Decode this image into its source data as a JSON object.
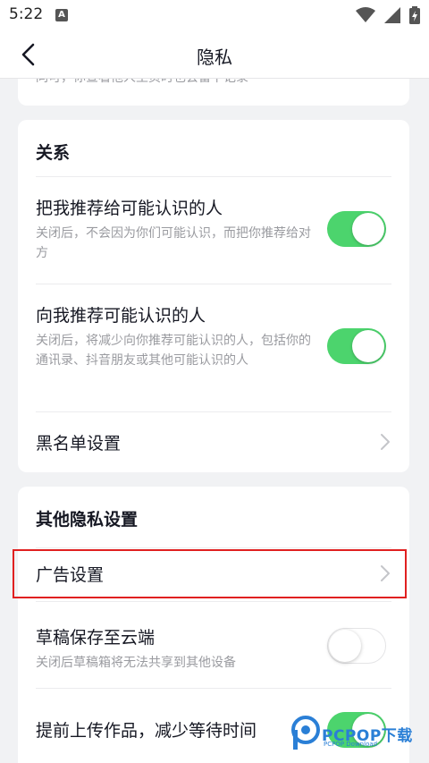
{
  "status_bar": {
    "time": "5:22",
    "notification_icon": "A",
    "icons": [
      "wifi-icon",
      "signal-icon",
      "battery-charging-icon"
    ]
  },
  "nav": {
    "title": "隐私",
    "back_icon": "chevron-left-icon"
  },
  "top_partial": {
    "text": "同可，你查看他人主页时也会留下记录"
  },
  "relations": {
    "title": "关系",
    "items": [
      {
        "label": "把我推荐给可能认识的人",
        "desc": "关闭后，不会因为你们可能认识，而把你推荐给对方",
        "toggle": "on"
      },
      {
        "label": "向我推荐可能认识的人",
        "desc": "关闭后，将减少向你推荐可能认识的人，包括你的通讯录、抖音朋友或其他可能认识的人",
        "toggle": "on"
      },
      {
        "label": "黑名单设置",
        "icon": "chevron-right-icon"
      }
    ]
  },
  "other": {
    "title": "其他隐私设置",
    "items": [
      {
        "label": "广告设置",
        "icon": "chevron-right-icon"
      },
      {
        "label": "草稿保存至云端",
        "desc": "关闭后草稿箱将无法共享到其他设备",
        "toggle": "off"
      },
      {
        "label": "提前上传作品，减少等待时间",
        "toggle": "on"
      }
    ]
  },
  "watermark": {
    "brand": "PCPOP下载",
    "sub": "PCPOP Download"
  },
  "colors": {
    "toggle_on": "#4cd46d",
    "highlight": "#e02020",
    "background": "#f1f2f4",
    "secondary_text": "#9a9ba0"
  }
}
